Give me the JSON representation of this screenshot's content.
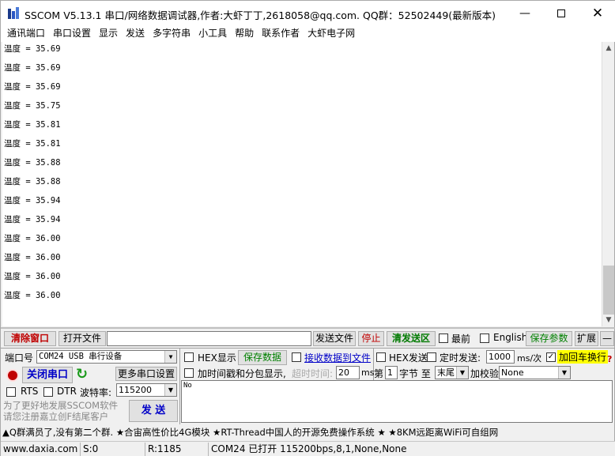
{
  "window": {
    "title": "SSCOM V5.13.1 串口/网络数据调试器,作者:大虾丁丁,2618058@qq.com. QQ群：52502449(最新版本)",
    "icons": {
      "app": "sscom-logo-icon",
      "minimize": "minimize-icon",
      "maximize": "maximize-icon",
      "close": "close-icon"
    }
  },
  "menu": [
    "通讯端口",
    "串口设置",
    "显示",
    "发送",
    "多字符串",
    "小工具",
    "帮助",
    "联系作者",
    "大虾电子网"
  ],
  "receive": {
    "lines": [
      "温度 = 35.69",
      "温度 = 35.69",
      "温度 = 35.69",
      "温度 = 35.75",
      "温度 = 35.81",
      "温度 = 35.81",
      "温度 = 35.88",
      "温度 = 35.88",
      "温度 = 35.94",
      "温度 = 35.94",
      "温度 = 36.00",
      "温度 = 36.00",
      "温度 = 36.00",
      "温度 = 36.00"
    ]
  },
  "toolbar": {
    "clear_window": "清除窗口",
    "open_file": "打开文件",
    "file_path": "",
    "send_file": "发送文件",
    "stop": "停止",
    "clear_send": "清发送区",
    "latest_label": "最前",
    "english_label": "English",
    "save_params": "保存参数",
    "expand": "扩展",
    "collapse": "—"
  },
  "port": {
    "port_label": "端口号",
    "port_value": "COM24 USB 串行设备",
    "close_port": "关闭串口",
    "more_settings": "更多串口设置",
    "rts_label": "RTS",
    "dtr_label": "DTR",
    "baud_label": "波特率:",
    "baud_value": "115200",
    "promo": "为了更好地发展SSCOM软件\n请您注册嘉立创F结尾客户",
    "send_button": "发 送"
  },
  "options": {
    "hex_display": "HEX显示",
    "save_data": "保存数据",
    "recv_to_file": "接收数据到文件",
    "hex_send": "HEX发送",
    "timed_send": "定时发送:",
    "interval_value": "1000",
    "interval_unit": "ms/次",
    "add_crlf": "加回车换行",
    "help_mark": "?",
    "timestamp": "加时间戳和分包显示,",
    "timeout_label": "超时时间:",
    "timeout_value": "20",
    "timeout_unit": "ms",
    "nth_label": "第",
    "nth_value": "1",
    "byte_label": "字节 至",
    "end_value": "末尾",
    "checksum_label": "加校验",
    "checksum_value": "None"
  },
  "send_text": "No",
  "ad_bar": "▲Q群满员了,没有第二个群. ★合宙高性价比4G模块 ★RT-Thread中国人的开源免费操作系统 ★ ★8KM远距离WiFi可自组网",
  "status": {
    "website": "www.daxia.com",
    "sent": "S:0",
    "received": "R:1185",
    "port_status": "COM24 已打开  115200bps,8,1,None,None"
  },
  "colors": {
    "clear_red": "#c00000",
    "stop_red": "#c00000",
    "clear_send_green": "#007a00",
    "save_green": "#008000",
    "port_blue": "#0000c8",
    "crlf_highlight": "#ffff00"
  }
}
